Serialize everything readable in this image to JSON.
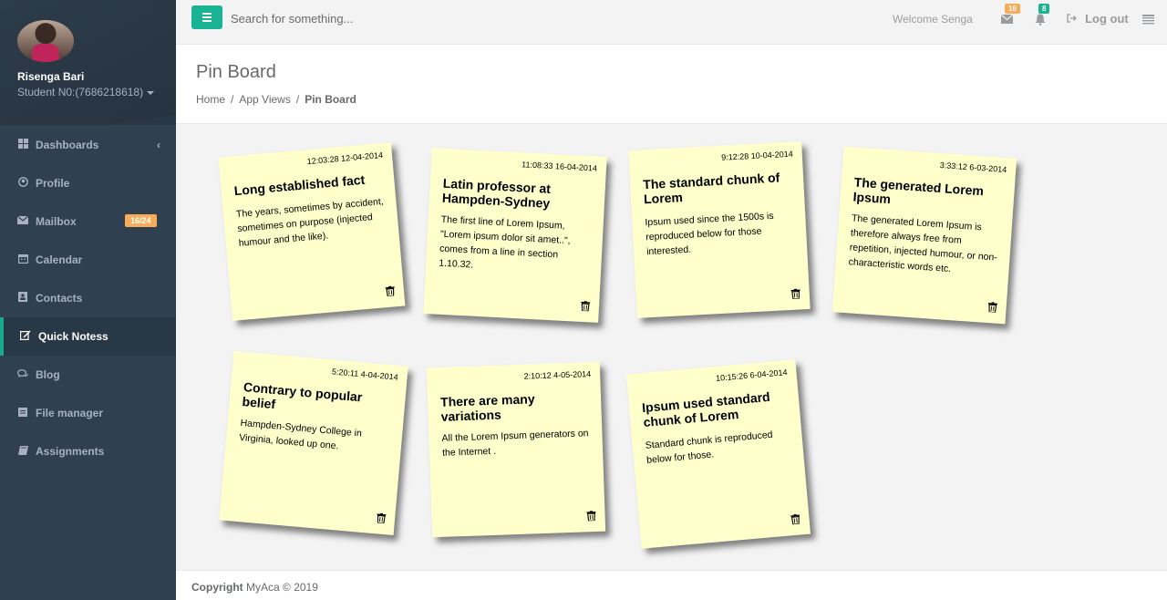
{
  "profile": {
    "name": "Risenga Bari",
    "role": "Student N0:(7686218618)"
  },
  "sidebar": {
    "items": [
      {
        "label": "Dashboards",
        "icon": "th-large-icon"
      },
      {
        "label": "Profile",
        "icon": "user-circle-icon"
      },
      {
        "label": "Mailbox",
        "icon": "envelope-icon",
        "badge": "16/24"
      },
      {
        "label": "Calendar",
        "icon": "calendar-icon"
      },
      {
        "label": "Contacts",
        "icon": "address-book-icon"
      },
      {
        "label": "Quick Notess",
        "icon": "edit-icon",
        "active": true
      },
      {
        "label": "Blog",
        "icon": "comments-icon"
      },
      {
        "label": "File manager",
        "icon": "folder-icon"
      },
      {
        "label": "Assignments",
        "icon": "book-icon"
      }
    ]
  },
  "topbar": {
    "search_placeholder": "Search for something...",
    "welcome": "Welcome Senga",
    "mail_count": "16",
    "bell_count": "8",
    "logout": "Log out"
  },
  "heading": {
    "title": "Pin Board",
    "breadcrumb": [
      "Home",
      "App Views",
      "Pin Board"
    ]
  },
  "notes": [
    {
      "date": "12:03:28 12-04-2014",
      "title": "Long established fact",
      "body": "The years, sometimes by accident, sometimes on purpose (injected humour and the like)."
    },
    {
      "date": "11:08:33 16-04-2014",
      "title": "Latin professor at Hampden-Sydney",
      "body": "The first line of Lorem Ipsum, \"Lorem ipsum dolor sit amet..\", comes from a line in section 1.10.32."
    },
    {
      "date": "9:12:28 10-04-2014",
      "title": "The standard chunk of Lorem",
      "body": "Ipsum used since the 1500s is reproduced below for those interested."
    },
    {
      "date": "3:33:12 6-03-2014",
      "title": "The generated Lorem Ipsum",
      "body": "The generated Lorem Ipsum is therefore always free from repetition, injected humour, or non-characteristic words etc."
    },
    {
      "date": "5:20:11 4-04-2014",
      "title": "Contrary to popular belief",
      "body": "Hampden-Sydney College in Virginia, looked up one."
    },
    {
      "date": "2:10:12 4-05-2014",
      "title": "There are many variations",
      "body": "All the Lorem Ipsum generators on the Internet ."
    },
    {
      "date": "10:15:26 6-04-2014",
      "title": "Ipsum used standard chunk of Lorem",
      "body": "Standard chunk is reproduced below for those."
    }
  ],
  "footer": {
    "copyright_label": "Copyright",
    "copyright_text": "MyAca © 2019"
  },
  "colors": {
    "sidebar": "#2f4050",
    "accent": "#1ab394",
    "note": "#ffffcc",
    "badge_warning": "#f8ac59"
  }
}
